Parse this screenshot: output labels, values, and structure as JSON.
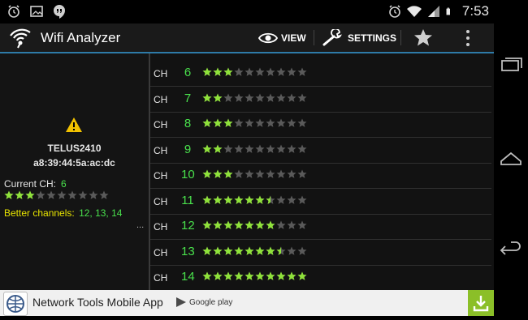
{
  "status_bar": {
    "time": "7:53"
  },
  "action_bar": {
    "title": "Wifi Analyzer",
    "view_label": "VIEW",
    "settings_label": "SETTINGS"
  },
  "network": {
    "ssid": "TELUS2410",
    "bssid": "a8:39:44:5a:ac:dc",
    "current_ch_label": "Current CH:",
    "current_ch": "6",
    "current_rating": 3,
    "better_label": "Better channels:",
    "better_value": "12, 13, 14",
    "more": "..."
  },
  "channels": [
    {
      "label": "CH",
      "num": "6",
      "rating": 3
    },
    {
      "label": "CH",
      "num": "7",
      "rating": 2
    },
    {
      "label": "CH",
      "num": "8",
      "rating": 3
    },
    {
      "label": "CH",
      "num": "9",
      "rating": 2
    },
    {
      "label": "CH",
      "num": "10",
      "rating": 3
    },
    {
      "label": "CH",
      "num": "11",
      "rating": 6.5
    },
    {
      "label": "CH",
      "num": "12",
      "rating": 7
    },
    {
      "label": "CH",
      "num": "13",
      "rating": 7.5
    },
    {
      "label": "CH",
      "num": "14",
      "rating": 10
    }
  ],
  "max_stars": 10,
  "ad": {
    "text": "Network Tools Mobile App",
    "store": "Google play"
  },
  "colors": {
    "accent": "#2e7ba8",
    "channel_green": "#49e04c",
    "star_green": "#8fe23a",
    "better_yellow": "#e8e400"
  }
}
